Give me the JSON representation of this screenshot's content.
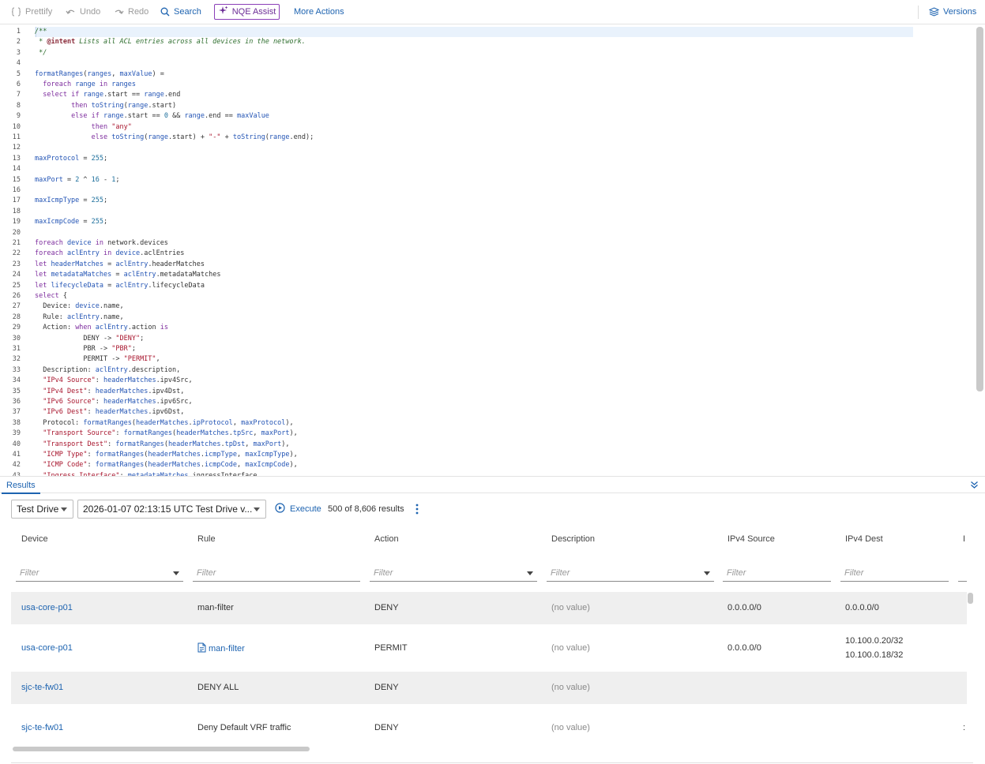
{
  "toolbar": {
    "prettify": "Prettify",
    "undo": "Undo",
    "redo": "Redo",
    "search": "Search",
    "nqe_assist": "NQE Assist",
    "more_actions": "More Actions",
    "versions": "Versions"
  },
  "editor": {
    "lines": [
      [
        [
          "com",
          "/**"
        ]
      ],
      [
        [
          "com",
          " * "
        ],
        [
          "ann",
          "@intent"
        ],
        [
          "com",
          " Lists all ACL entries across all devices in the network."
        ]
      ],
      [
        [
          "com",
          " */"
        ]
      ],
      [],
      [
        [
          "id",
          "formatRanges"
        ],
        [
          "txt",
          "("
        ],
        [
          "id",
          "ranges"
        ],
        [
          "txt",
          ", "
        ],
        [
          "id",
          "maxValue"
        ],
        [
          "txt",
          ") ="
        ]
      ],
      [
        [
          "txt",
          "  "
        ],
        [
          "kw",
          "foreach"
        ],
        [
          "txt",
          " "
        ],
        [
          "id",
          "range"
        ],
        [
          "txt",
          " "
        ],
        [
          "kw",
          "in"
        ],
        [
          "txt",
          " "
        ],
        [
          "id",
          "ranges"
        ]
      ],
      [
        [
          "txt",
          "  "
        ],
        [
          "kw",
          "select"
        ],
        [
          "txt",
          " "
        ],
        [
          "kw",
          "if"
        ],
        [
          "txt",
          " "
        ],
        [
          "id",
          "range"
        ],
        [
          "txt",
          ".start == "
        ],
        [
          "id",
          "range"
        ],
        [
          "txt",
          ".end"
        ]
      ],
      [
        [
          "txt",
          "         "
        ],
        [
          "kw",
          "then"
        ],
        [
          "txt",
          " "
        ],
        [
          "id",
          "toString"
        ],
        [
          "txt",
          "("
        ],
        [
          "id",
          "range"
        ],
        [
          "txt",
          ".start)"
        ]
      ],
      [
        [
          "txt",
          "         "
        ],
        [
          "kw",
          "else"
        ],
        [
          "txt",
          " "
        ],
        [
          "kw",
          "if"
        ],
        [
          "txt",
          " "
        ],
        [
          "id",
          "range"
        ],
        [
          "txt",
          ".start == "
        ],
        [
          "num",
          "0"
        ],
        [
          "txt",
          " && "
        ],
        [
          "id",
          "range"
        ],
        [
          "txt",
          ".end == "
        ],
        [
          "id",
          "maxValue"
        ]
      ],
      [
        [
          "txt",
          "              "
        ],
        [
          "kw",
          "then"
        ],
        [
          "txt",
          " "
        ],
        [
          "str",
          "\"any\""
        ]
      ],
      [
        [
          "txt",
          "              "
        ],
        [
          "kw",
          "else"
        ],
        [
          "txt",
          " "
        ],
        [
          "id",
          "toString"
        ],
        [
          "txt",
          "("
        ],
        [
          "id",
          "range"
        ],
        [
          "txt",
          ".start) + "
        ],
        [
          "str",
          "\"-\""
        ],
        [
          "txt",
          " + "
        ],
        [
          "id",
          "toString"
        ],
        [
          "txt",
          "("
        ],
        [
          "id",
          "range"
        ],
        [
          "txt",
          ".end);"
        ]
      ],
      [],
      [
        [
          "id",
          "maxProtocol"
        ],
        [
          "txt",
          " = "
        ],
        [
          "num",
          "255"
        ],
        [
          "txt",
          ";"
        ]
      ],
      [],
      [
        [
          "id",
          "maxPort"
        ],
        [
          "txt",
          " = "
        ],
        [
          "num",
          "2"
        ],
        [
          "txt",
          " ^ "
        ],
        [
          "num",
          "16"
        ],
        [
          "txt",
          " - "
        ],
        [
          "num",
          "1"
        ],
        [
          "txt",
          ";"
        ]
      ],
      [],
      [
        [
          "id",
          "maxIcmpType"
        ],
        [
          "txt",
          " = "
        ],
        [
          "num",
          "255"
        ],
        [
          "txt",
          ";"
        ]
      ],
      [],
      [
        [
          "id",
          "maxIcmpCode"
        ],
        [
          "txt",
          " = "
        ],
        [
          "num",
          "255"
        ],
        [
          "txt",
          ";"
        ]
      ],
      [],
      [
        [
          "kw",
          "foreach"
        ],
        [
          "txt",
          " "
        ],
        [
          "id",
          "device"
        ],
        [
          "txt",
          " "
        ],
        [
          "kw",
          "in"
        ],
        [
          "txt",
          " network.devices"
        ]
      ],
      [
        [
          "kw",
          "foreach"
        ],
        [
          "txt",
          " "
        ],
        [
          "id",
          "aclEntry"
        ],
        [
          "txt",
          " "
        ],
        [
          "kw",
          "in"
        ],
        [
          "txt",
          " "
        ],
        [
          "id",
          "device"
        ],
        [
          "txt",
          ".aclEntries"
        ]
      ],
      [
        [
          "kw",
          "let"
        ],
        [
          "txt",
          " "
        ],
        [
          "id",
          "headerMatches"
        ],
        [
          "txt",
          " = "
        ],
        [
          "id",
          "aclEntry"
        ],
        [
          "txt",
          ".headerMatches"
        ]
      ],
      [
        [
          "kw",
          "let"
        ],
        [
          "txt",
          " "
        ],
        [
          "id",
          "metadataMatches"
        ],
        [
          "txt",
          " = "
        ],
        [
          "id",
          "aclEntry"
        ],
        [
          "txt",
          ".metadataMatches"
        ]
      ],
      [
        [
          "kw",
          "let"
        ],
        [
          "txt",
          " "
        ],
        [
          "id",
          "lifecycleData"
        ],
        [
          "txt",
          " = "
        ],
        [
          "id",
          "aclEntry"
        ],
        [
          "txt",
          ".lifecycleData"
        ]
      ],
      [
        [
          "kw",
          "select"
        ],
        [
          "txt",
          " {"
        ]
      ],
      [
        [
          "txt",
          "  Device: "
        ],
        [
          "id",
          "device"
        ],
        [
          "txt",
          ".name,"
        ]
      ],
      [
        [
          "txt",
          "  Rule: "
        ],
        [
          "id",
          "aclEntry"
        ],
        [
          "txt",
          ".name,"
        ]
      ],
      [
        [
          "txt",
          "  Action: "
        ],
        [
          "kw",
          "when"
        ],
        [
          "txt",
          " "
        ],
        [
          "id",
          "aclEntry"
        ],
        [
          "txt",
          ".action "
        ],
        [
          "kw",
          "is"
        ]
      ],
      [
        [
          "txt",
          "            DENY -> "
        ],
        [
          "str",
          "\"DENY\""
        ],
        [
          "txt",
          ";"
        ]
      ],
      [
        [
          "txt",
          "            PBR -> "
        ],
        [
          "str",
          "\"PBR\""
        ],
        [
          "txt",
          ";"
        ]
      ],
      [
        [
          "txt",
          "            PERMIT -> "
        ],
        [
          "str",
          "\"PERMIT\""
        ],
        [
          "txt",
          ","
        ]
      ],
      [
        [
          "txt",
          "  Description: "
        ],
        [
          "id",
          "aclEntry"
        ],
        [
          "txt",
          ".description,"
        ]
      ],
      [
        [
          "txt",
          "  "
        ],
        [
          "str",
          "\"IPv4 Source\""
        ],
        [
          "txt",
          ": "
        ],
        [
          "id",
          "headerMatches"
        ],
        [
          "txt",
          ".ipv4Src,"
        ]
      ],
      [
        [
          "txt",
          "  "
        ],
        [
          "str",
          "\"IPv4 Dest\""
        ],
        [
          "txt",
          ": "
        ],
        [
          "id",
          "headerMatches"
        ],
        [
          "txt",
          ".ipv4Dst,"
        ]
      ],
      [
        [
          "txt",
          "  "
        ],
        [
          "str",
          "\"IPv6 Source\""
        ],
        [
          "txt",
          ": "
        ],
        [
          "id",
          "headerMatches"
        ],
        [
          "txt",
          ".ipv6Src,"
        ]
      ],
      [
        [
          "txt",
          "  "
        ],
        [
          "str",
          "\"IPv6 Dest\""
        ],
        [
          "txt",
          ": "
        ],
        [
          "id",
          "headerMatches"
        ],
        [
          "txt",
          ".ipv6Dst,"
        ]
      ],
      [
        [
          "txt",
          "  Protocol: "
        ],
        [
          "id",
          "formatRanges"
        ],
        [
          "txt",
          "("
        ],
        [
          "id",
          "headerMatches"
        ],
        [
          "txt",
          "."
        ],
        [
          "id",
          "ipProtocol"
        ],
        [
          "txt",
          ", "
        ],
        [
          "id",
          "maxProtocol"
        ],
        [
          "txt",
          "),"
        ]
      ],
      [
        [
          "txt",
          "  "
        ],
        [
          "str",
          "\"Transport Source\""
        ],
        [
          "txt",
          ": "
        ],
        [
          "id",
          "formatRanges"
        ],
        [
          "txt",
          "("
        ],
        [
          "id",
          "headerMatches"
        ],
        [
          "txt",
          "."
        ],
        [
          "id",
          "tpSrc"
        ],
        [
          "txt",
          ", "
        ],
        [
          "id",
          "maxPort"
        ],
        [
          "txt",
          "),"
        ]
      ],
      [
        [
          "txt",
          "  "
        ],
        [
          "str",
          "\"Transport Dest\""
        ],
        [
          "txt",
          ": "
        ],
        [
          "id",
          "formatRanges"
        ],
        [
          "txt",
          "("
        ],
        [
          "id",
          "headerMatches"
        ],
        [
          "txt",
          "."
        ],
        [
          "id",
          "tpDst"
        ],
        [
          "txt",
          ", "
        ],
        [
          "id",
          "maxPort"
        ],
        [
          "txt",
          "),"
        ]
      ],
      [
        [
          "txt",
          "  "
        ],
        [
          "str",
          "\"ICMP Type\""
        ],
        [
          "txt",
          ": "
        ],
        [
          "id",
          "formatRanges"
        ],
        [
          "txt",
          "("
        ],
        [
          "id",
          "headerMatches"
        ],
        [
          "txt",
          "."
        ],
        [
          "id",
          "icmpType"
        ],
        [
          "txt",
          ", "
        ],
        [
          "id",
          "maxIcmpType"
        ],
        [
          "txt",
          "),"
        ]
      ],
      [
        [
          "txt",
          "  "
        ],
        [
          "str",
          "\"ICMP Code\""
        ],
        [
          "txt",
          ": "
        ],
        [
          "id",
          "formatRanges"
        ],
        [
          "txt",
          "("
        ],
        [
          "id",
          "headerMatches"
        ],
        [
          "txt",
          "."
        ],
        [
          "id",
          "icmpCode"
        ],
        [
          "txt",
          ", "
        ],
        [
          "id",
          "maxIcmpCode"
        ],
        [
          "txt",
          "),"
        ]
      ],
      [
        [
          "txt",
          "  "
        ],
        [
          "str",
          "\"Ingress Interface\""
        ],
        [
          "txt",
          ": "
        ],
        [
          "id",
          "metadataMatches"
        ],
        [
          "txt",
          ".ingressInterface,"
        ]
      ]
    ]
  },
  "results": {
    "tab_label": "Results",
    "network_select": "Test Drive",
    "snapshot_select": "2026-01-07 02:13:15 UTC Test Drive v...",
    "execute_label": "Execute",
    "count_text": "500 of 8,606 results",
    "filter_placeholder": "Filter",
    "columns": [
      "Device",
      "Rule",
      "Action",
      "Description",
      "IPv4 Source",
      "IPv4 Dest",
      "I"
    ],
    "rows": [
      {
        "device": "usa-core-p01",
        "rule": "man-filter",
        "rule_has_doc": false,
        "action": "DENY",
        "description": "(no value)",
        "ipv4_source": "0.0.0.0/0",
        "ipv4_dest": [
          "0.0.0.0/0"
        ]
      },
      {
        "device": "usa-core-p01",
        "rule": "man-filter",
        "rule_has_doc": true,
        "action": "PERMIT",
        "description": "(no value)",
        "ipv4_source": "0.0.0.0/0",
        "ipv4_dest": [
          "10.100.0.20/32",
          "10.100.0.18/32"
        ]
      },
      {
        "device": "sjc-te-fw01",
        "rule": "DENY ALL",
        "rule_has_doc": false,
        "action": "DENY",
        "description": "(no value)",
        "ipv4_source": "",
        "ipv4_dest": []
      },
      {
        "device": "sjc-te-fw01",
        "rule": "Deny Default VRF traffic",
        "rule_has_doc": false,
        "action": "DENY",
        "description": "(no value)",
        "ipv4_source": "",
        "ipv4_dest": [],
        "overflow": ":"
      }
    ]
  },
  "colors": {
    "accent": "#1d63b0",
    "nqe_purple": "#8b3fb8",
    "row_shade": "#efefef"
  }
}
